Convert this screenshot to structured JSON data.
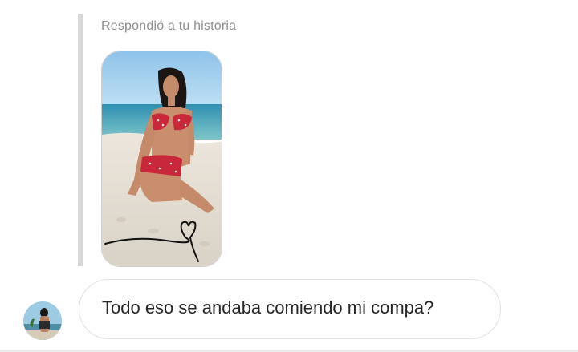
{
  "reply_context": {
    "label": "Respondió a tu historia"
  },
  "story_preview": {
    "image": "beach-story-photo",
    "doodle": "heart-line-doodle"
  },
  "message": {
    "text": "Todo eso se andaba comiendo mi compa?"
  },
  "avatar": {
    "image": "user-avatar-photo"
  },
  "colors": {
    "background": "#ffffff",
    "quote_bar": "#d8d8d8",
    "muted_text": "#8e8e8e",
    "message_text": "#262626",
    "bubble_border": "#e1e1e1"
  }
}
